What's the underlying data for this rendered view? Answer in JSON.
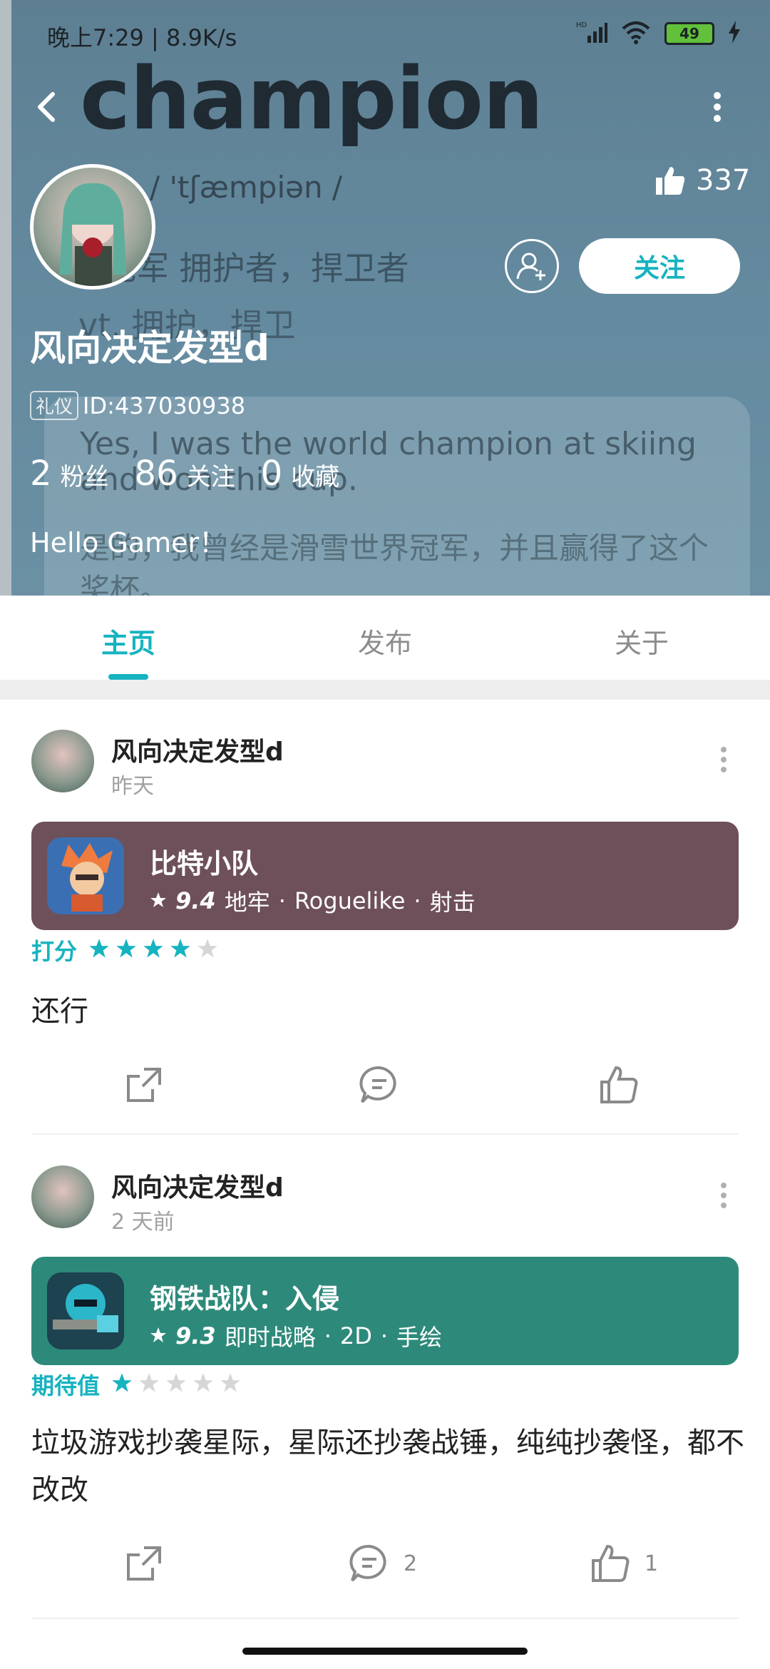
{
  "status_bar": {
    "time": "晚上7:29 | 8.9K/s",
    "signal": "HD",
    "battery": "49"
  },
  "background": {
    "word": "champion",
    "phonetic": "/ 'tʃæmpiən /",
    "def_line1": "冠军   拥护者，捍卫者",
    "def_line2": "vt. 拥护，捍卫",
    "example_en": "Yes, I was the world champion at skiing and won this cup.",
    "example_cn": "是的，我曾经是滑雪世界冠军，并且赢得了这个奖杯。"
  },
  "profile": {
    "likes": "337",
    "follow_label": "关注",
    "username": "风向决定发型d",
    "badge": "礼仪",
    "id": "ID:437030938",
    "stats": [
      {
        "num": "2",
        "label": "粉丝"
      },
      {
        "num": "86",
        "label": "关注"
      },
      {
        "num": "0",
        "label": "收藏"
      }
    ],
    "bio": "Hello Gamer！"
  },
  "tabs": [
    {
      "label": "主页",
      "active": true
    },
    {
      "label": "发布",
      "active": false
    },
    {
      "label": "关于",
      "active": false
    }
  ],
  "posts": [
    {
      "author": "风向决定发型d",
      "time": "昨天",
      "game": {
        "title": "比特小队",
        "score": "9.4",
        "tags": [
          "地牢",
          "Roguelike",
          "射击"
        ],
        "card_color": "#6e505a"
      },
      "rating_label": "打分",
      "stars": 4,
      "text": "还行",
      "comments": "",
      "likes": ""
    },
    {
      "author": "风向决定发型d",
      "time": "2 天前",
      "game": {
        "title": "钢铁战队：入侵",
        "score": "9.3",
        "tags": [
          "即时战略",
          "2D",
          "手绘"
        ],
        "card_color": "#2d8a7a"
      },
      "rating_label": "期待值",
      "stars": 1,
      "text": "垃圾游戏抄袭星际，星际还抄袭战锤，纯纯抄袭怪，都不改改",
      "comments": "2",
      "likes": "1"
    }
  ],
  "colors": {
    "accent": "#16b3c0",
    "star_empty": "#d6d6d6"
  }
}
